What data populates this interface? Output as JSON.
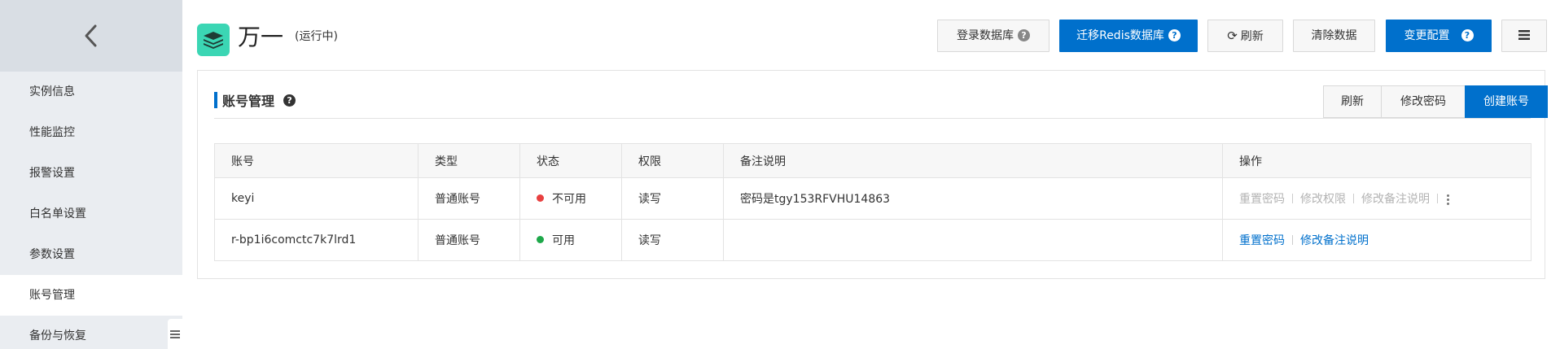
{
  "sidebar": {
    "items": [
      {
        "label": "实例信息"
      },
      {
        "label": "性能监控"
      },
      {
        "label": "报警设置"
      },
      {
        "label": "白名单设置"
      },
      {
        "label": "参数设置"
      },
      {
        "label": "账号管理",
        "active": true
      },
      {
        "label": "备份与恢复"
      }
    ]
  },
  "header": {
    "title": "万一",
    "status": "(运行中)",
    "buttons": {
      "login": "登录数据库",
      "migrate": "迁移Redis数据库",
      "refresh": "刷新",
      "clear": "清除数据",
      "change": "变更配置"
    }
  },
  "panel": {
    "title": "账号管理",
    "tools": {
      "refresh": "刷新",
      "change_password": "修改密码",
      "create_account": "创建账号"
    },
    "table": {
      "columns": [
        "账号",
        "类型",
        "状态",
        "权限",
        "备注说明",
        "操作"
      ],
      "rows": [
        {
          "account": "keyi",
          "type": "普通账号",
          "status": "不可用",
          "status_color": "#e84040",
          "permission": "读写",
          "note": "密码是tgy153RFVHU14863",
          "ops": [
            "重置密码",
            "修改权限",
            "修改备注说明"
          ]
        },
        {
          "account": "r-bp1i6comctc7k7lrd1",
          "type": "普通账号",
          "status": "可用",
          "status_color": "#1ea84a",
          "permission": "读写",
          "note": "",
          "ops": [
            "重置密码",
            "修改备注说明"
          ]
        }
      ]
    }
  },
  "colors": {
    "accent": "#0070cc",
    "brand_orange": "#ff6a00",
    "app_icon": "#3bd6b4"
  },
  "icons": [
    "chevron-left-icon",
    "database-stack-icon",
    "question-icon",
    "refresh-icon",
    "menu-icon",
    "more-vertical-icon"
  ]
}
